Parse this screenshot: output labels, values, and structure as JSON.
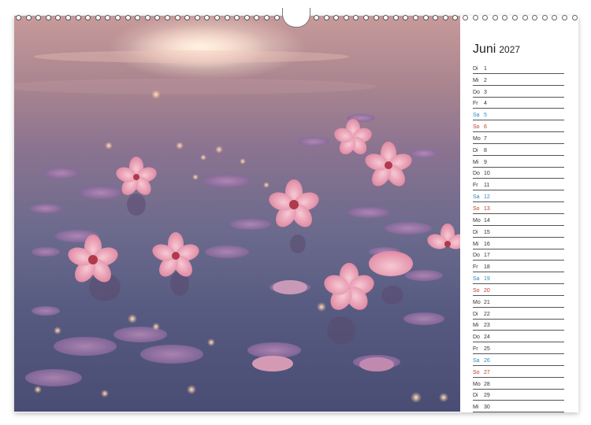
{
  "calendar": {
    "month": "Juni",
    "year": "2027",
    "days": [
      {
        "name": "Di",
        "day": "1",
        "type": "weekday"
      },
      {
        "name": "Mi",
        "day": "2",
        "type": "weekday"
      },
      {
        "name": "Do",
        "day": "3",
        "type": "weekday"
      },
      {
        "name": "Fr",
        "day": "4",
        "type": "weekday"
      },
      {
        "name": "Sa",
        "day": "5",
        "type": "sa"
      },
      {
        "name": "So",
        "day": "6",
        "type": "so"
      },
      {
        "name": "Mo",
        "day": "7",
        "type": "weekday"
      },
      {
        "name": "Di",
        "day": "8",
        "type": "weekday"
      },
      {
        "name": "Mi",
        "day": "9",
        "type": "weekday"
      },
      {
        "name": "Do",
        "day": "10",
        "type": "weekday"
      },
      {
        "name": "Fr",
        "day": "11",
        "type": "weekday"
      },
      {
        "name": "Sa",
        "day": "12",
        "type": "sa"
      },
      {
        "name": "So",
        "day": "13",
        "type": "so"
      },
      {
        "name": "Mo",
        "day": "14",
        "type": "weekday"
      },
      {
        "name": "Di",
        "day": "15",
        "type": "weekday"
      },
      {
        "name": "Mi",
        "day": "16",
        "type": "weekday"
      },
      {
        "name": "Do",
        "day": "17",
        "type": "weekday"
      },
      {
        "name": "Fr",
        "day": "18",
        "type": "weekday"
      },
      {
        "name": "Sa",
        "day": "19",
        "type": "sa"
      },
      {
        "name": "So",
        "day": "20",
        "type": "so"
      },
      {
        "name": "Mo",
        "day": "21",
        "type": "weekday"
      },
      {
        "name": "Di",
        "day": "22",
        "type": "weekday"
      },
      {
        "name": "Mi",
        "day": "23",
        "type": "weekday"
      },
      {
        "name": "Do",
        "day": "24",
        "type": "weekday"
      },
      {
        "name": "Fr",
        "day": "25",
        "type": "weekday"
      },
      {
        "name": "Sa",
        "day": "26",
        "type": "sa"
      },
      {
        "name": "So",
        "day": "27",
        "type": "so"
      },
      {
        "name": "Mo",
        "day": "28",
        "type": "weekday"
      },
      {
        "name": "Di",
        "day": "29",
        "type": "weekday"
      },
      {
        "name": "Mi",
        "day": "30",
        "type": "weekday"
      }
    ]
  },
  "colors": {
    "saturday": "#2f88bf",
    "sunday": "#c0392b",
    "rule": "#555555",
    "petal": "#f1b7c6"
  },
  "photo": {
    "subject_icon": "cherry-blossom-petals-on-water"
  }
}
